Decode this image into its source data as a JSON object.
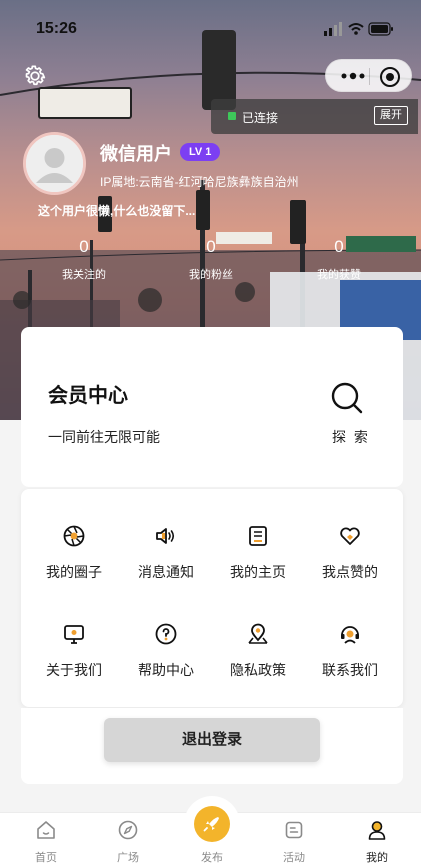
{
  "status_bar": {
    "time": "15:26"
  },
  "connection": {
    "status_text": "已连接",
    "expand_label": "展开",
    "dot_color": "#3ec75a"
  },
  "profile": {
    "nickname": "微信用户",
    "level": "LV 1",
    "ip_location": "IP属地:云南省-红河哈尼族彝族自治州",
    "bio": "这个用户很懒,什么也没留下...",
    "stats": [
      {
        "value": "0",
        "label": "我关注的"
      },
      {
        "value": "0",
        "label": "我的粉丝"
      },
      {
        "value": "0",
        "label": "我的获赞"
      }
    ]
  },
  "member_center": {
    "title": "会员中心",
    "subtitle": "一同前往无限可能",
    "explore_label": "探 索"
  },
  "menu": [
    {
      "label": "我的圈子",
      "icon": "aperture-icon"
    },
    {
      "label": "消息通知",
      "icon": "speaker-icon"
    },
    {
      "label": "我的主页",
      "icon": "homepage-icon"
    },
    {
      "label": "我点赞的",
      "icon": "heart-icon"
    },
    {
      "label": "关于我们",
      "icon": "monitor-icon"
    },
    {
      "label": "帮助中心",
      "icon": "help-icon"
    },
    {
      "label": "隐私政策",
      "icon": "map-pin-icon"
    },
    {
      "label": "联系我们",
      "icon": "support-agent-icon"
    }
  ],
  "logout_label": "退出登录",
  "tabbar": [
    {
      "label": "首页",
      "icon": "home-icon"
    },
    {
      "label": "广场",
      "icon": "compass-icon"
    },
    {
      "label": "发布",
      "icon": "rocket-icon"
    },
    {
      "label": "活动",
      "icon": "activity-icon"
    },
    {
      "label": "我的",
      "icon": "user-icon",
      "active": true
    }
  ],
  "colors": {
    "accent_purple": "#7c3ff2",
    "accent_yellow": "#f3b42b",
    "accent_orange": "#f0a030"
  }
}
